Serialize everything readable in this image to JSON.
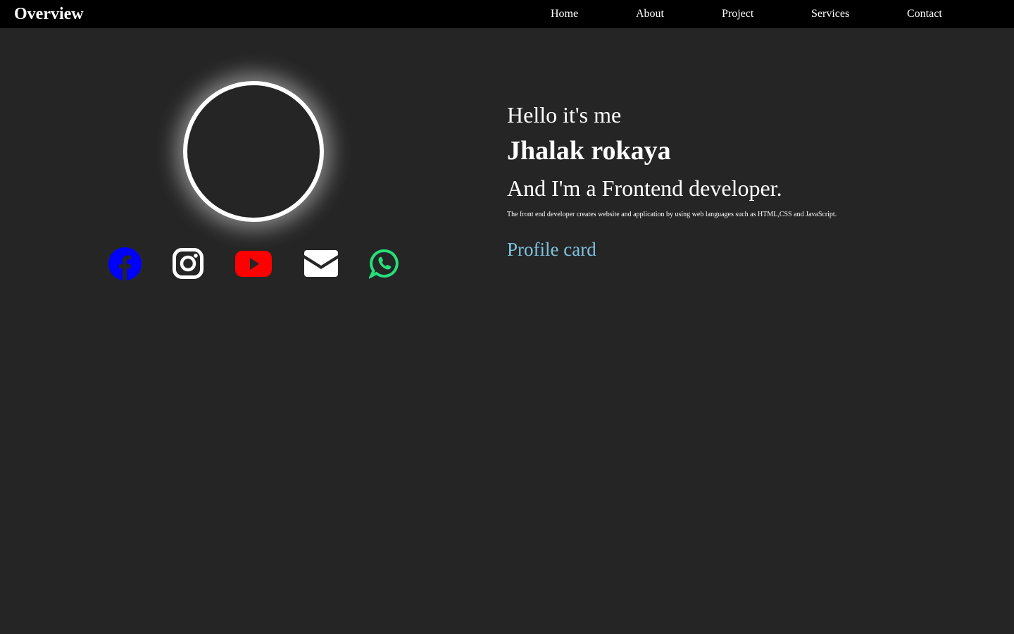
{
  "navbar": {
    "brand": "Overview",
    "links": [
      {
        "label": "Home"
      },
      {
        "label": "About"
      },
      {
        "label": "Project"
      },
      {
        "label": "Services"
      },
      {
        "label": "Contact"
      }
    ]
  },
  "profile": {
    "social_icons": [
      {
        "icon": "facebook-icon",
        "color": "#0000ff"
      },
      {
        "icon": "instagram-icon",
        "color": "#ffffff"
      },
      {
        "icon": "youtube-icon",
        "color": "#ff0000"
      },
      {
        "icon": "envelope-icon",
        "color": "#ffffff"
      },
      {
        "icon": "whatsapp-icon",
        "color": "#25e07a"
      }
    ]
  },
  "intro": {
    "greeting": "Hello it's me",
    "name": "Jhalak rokaya",
    "role": "And I'm a Frontend developer.",
    "description": "The front end developer creates website and application by using web languages such as HTML,CSS and JavaScript.",
    "cta_label": "Profile card"
  },
  "colors": {
    "background": "#252525",
    "navbar": "#000000",
    "cta": "#7ec3e0"
  }
}
